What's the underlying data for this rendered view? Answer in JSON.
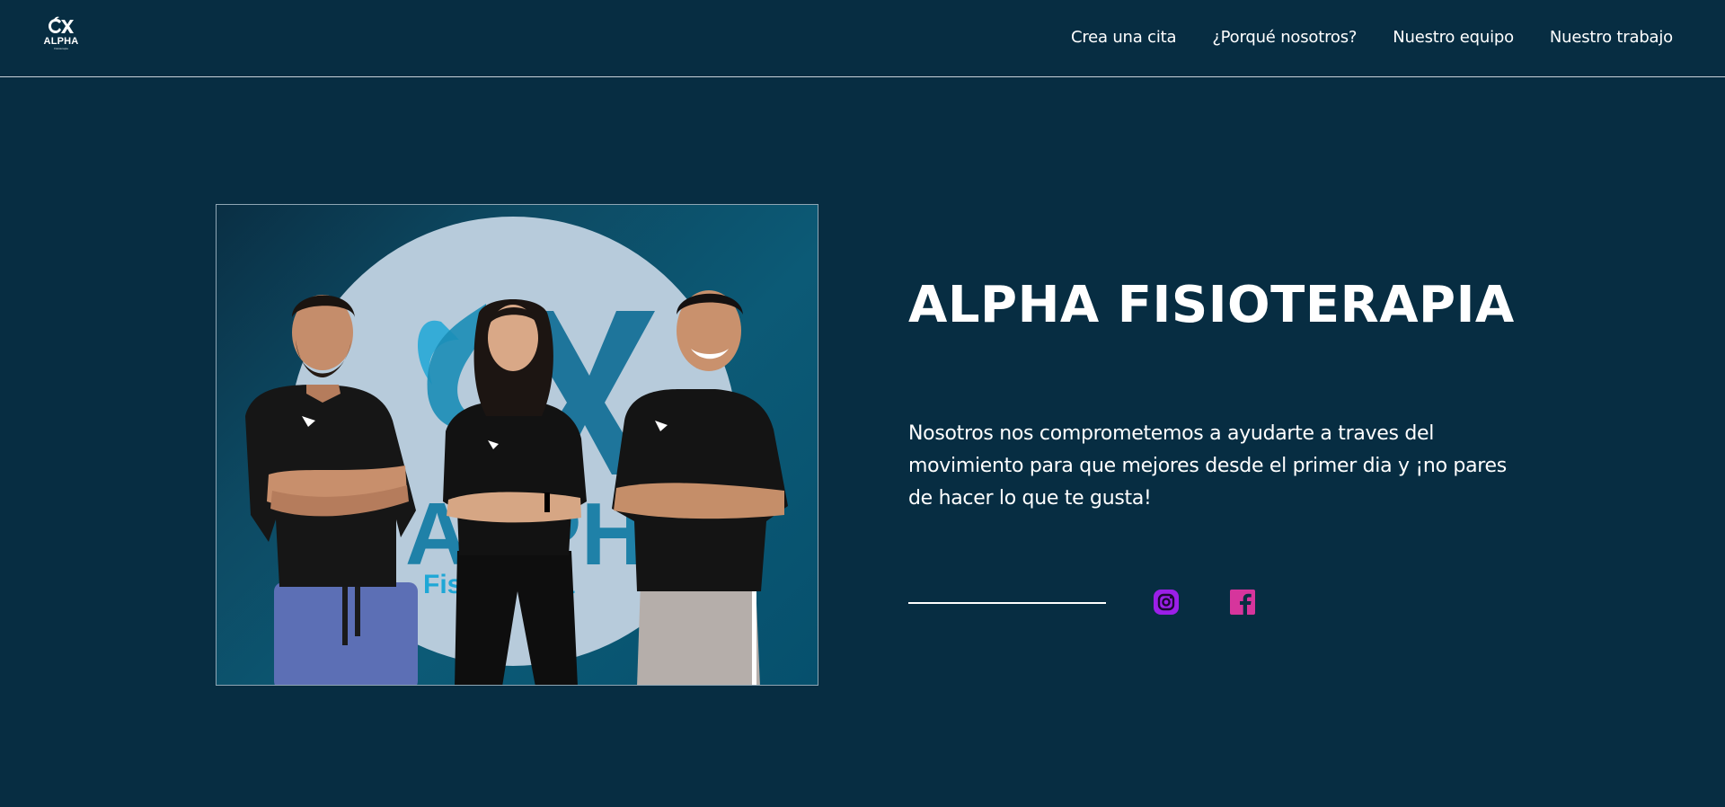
{
  "header": {
    "logo": {
      "name": "alpha-logo-icon",
      "word": "ALPHA",
      "subtitle": "Fisioterapia"
    },
    "nav": [
      {
        "label": "Crea una cita"
      },
      {
        "label": "¿Porqué nosotros?"
      },
      {
        "label": "Nuestro equipo"
      },
      {
        "label": "Nuestro trabajo"
      }
    ]
  },
  "hero": {
    "image": {
      "content": "team-photo",
      "background_logo_text": "ALPHA",
      "background_logo_subtext": "Fisioterapia"
    },
    "title": "ALPHA FISIOTERAPIA",
    "description": "Nosotros nos comprometemos a ayudarte a traves del movimiento para que mejores desde el primer dia y ¡no pares de hacer lo que te gusta!",
    "social": [
      {
        "name": "instagram-icon",
        "color": "#9b1fe8"
      },
      {
        "name": "facebook-icon",
        "color": "#d6359c"
      }
    ]
  },
  "colors": {
    "background": "#072d42",
    "text": "#ffffff",
    "accent": "#1ea7d6"
  }
}
